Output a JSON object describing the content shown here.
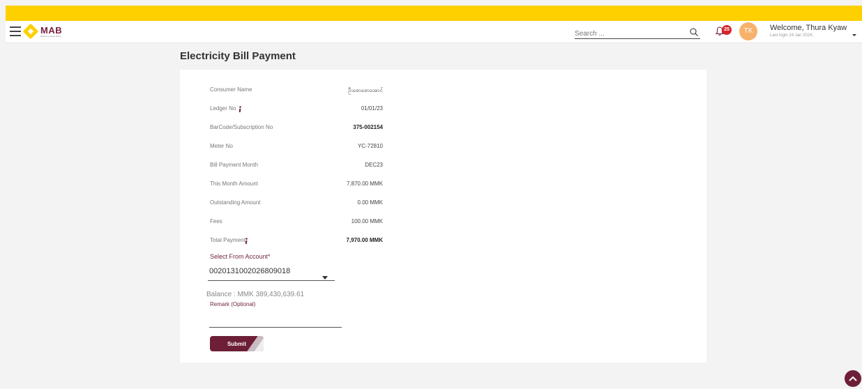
{
  "header": {
    "logo_text": "MAB",
    "logo_subtext": "Myanma Apex Bank",
    "search_placeholder": "Search ...",
    "notification_count": "25",
    "avatar_initials": "TK",
    "welcome_text": "Welcome, Thura Kyaw",
    "last_login": "Last login 24 Jan 2024,"
  },
  "page": {
    "title": "Electricity Bill Payment"
  },
  "details": [
    {
      "label": "Consumer Name",
      "value": "ဦးစောစောအောင်",
      "info": false,
      "bold": false
    },
    {
      "label": "Ledger No",
      "value": "01/01/23",
      "info": true,
      "bold": false
    },
    {
      "label": "BarCode/Subscription No",
      "value": "375-002154",
      "info": false,
      "bold": true
    },
    {
      "label": "Meter No",
      "value": "YC-72810",
      "info": false,
      "bold": false
    },
    {
      "label": "Bill Payment Month",
      "value": "DEC23",
      "info": false,
      "bold": false
    },
    {
      "label": "This Month Amount",
      "value": "7,870.00 MMK",
      "info": false,
      "bold": false
    },
    {
      "label": "Outstanding Amount",
      "value": "0.00 MMK",
      "info": false,
      "bold": false
    },
    {
      "label": "Fees",
      "value": "100.00 MMK",
      "info": false,
      "bold": false
    },
    {
      "label": "Total Payment",
      "value": "7,970.00 MMK",
      "info": true,
      "bold": true
    }
  ],
  "form": {
    "select_label": "Select From Account*",
    "selected_account": "0020131002026809018",
    "balance_text": "Balance : MMK 389,430,639.61",
    "remark_label": "Remark (Optional)",
    "remark_value": "",
    "submit_label": "Submit"
  },
  "colors": {
    "brand_yellow": "#fed000",
    "brand_maroon": "#6d1f38",
    "badge_red": "#d7262b",
    "avatar_orange": "#f6b26b"
  }
}
